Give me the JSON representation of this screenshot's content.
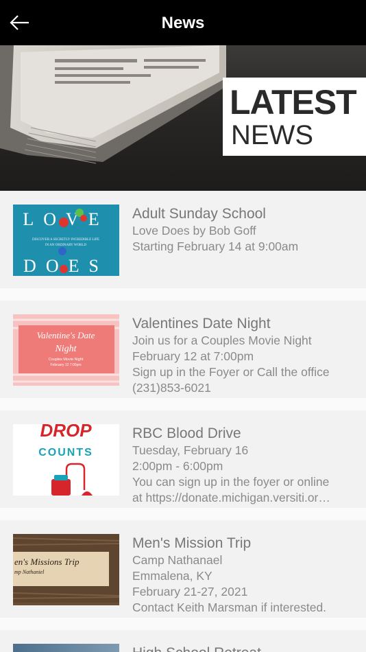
{
  "header": {
    "title": "News"
  },
  "hero": {
    "line1": "LATEST",
    "line2": "NEWS"
  },
  "items": [
    {
      "title": "Adult Sunday School",
      "lines": [
        "Love Does by Bob Goff",
        "Starting February 14 at 9:00am"
      ],
      "thumb": {
        "top": "LOVE",
        "sub1": "DISCOVER A SECRETLY INCREDIBLE LIFE",
        "sub2": "IN AN ORDINARY WORLD",
        "bottom": "DOES"
      }
    },
    {
      "title": "Valentines Date Night",
      "lines": [
        "Join us for a Couples Movie Night",
        "February 12 at 7:00pm",
        "Sign up in the Foyer or Call the office",
        "(231)853-6021"
      ],
      "thumb": {
        "t1": "Valentine's Date",
        "t2": "Night",
        "t3": "Couples Movie Night",
        "t4": "February 12 7:00pm"
      }
    },
    {
      "title": "RBC Blood Drive",
      "lines": [
        "Tuesday, February 16",
        "2:00pm - 6:00pm",
        "You can sign up in the foyer or online",
        "at https://donate.michigan.versiti.or…"
      ],
      "thumb": {
        "t1": "DROP",
        "t2": "COUNTS"
      }
    },
    {
      "title": "Men's Mission Trip",
      "lines": [
        "Camp Nathanael",
        "Emmalena, KY",
        "February 21-27, 2021",
        "Contact Keith Marsman if interested."
      ],
      "thumb": {
        "t1": "en's Missions Trip",
        "t2": "mp Nathaniel"
      }
    },
    {
      "title": "High School Retreat",
      "lines": []
    }
  ]
}
